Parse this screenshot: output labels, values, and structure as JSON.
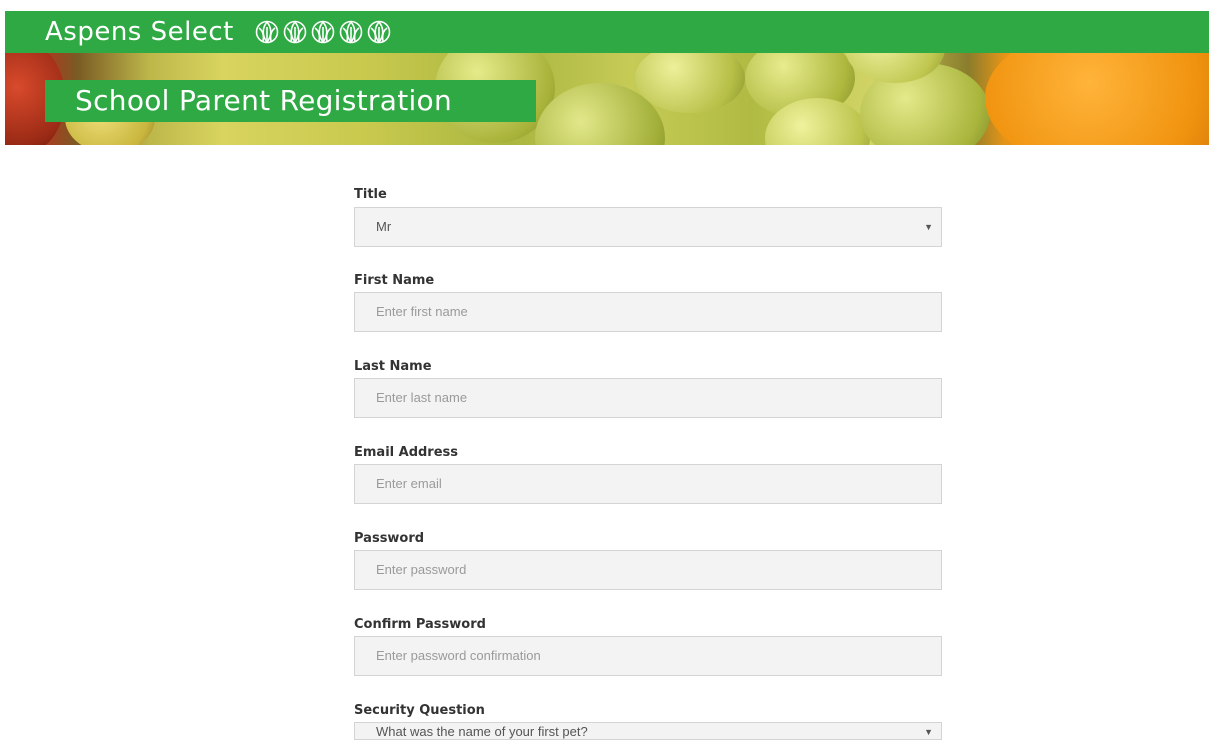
{
  "header": {
    "brand": "Aspens Select",
    "logo_icons": [
      "aspen-leaf-icon",
      "aspen-leaf-icon",
      "aspen-leaf-icon",
      "aspen-leaf-icon",
      "aspen-leaf-icon"
    ]
  },
  "banner": {
    "title": "School Parent Registration"
  },
  "form": {
    "title": {
      "label": "Title",
      "value": "Mr"
    },
    "first_name": {
      "label": "First Name",
      "placeholder": "Enter first name"
    },
    "last_name": {
      "label": "Last Name",
      "placeholder": "Enter last name"
    },
    "email": {
      "label": "Email Address",
      "placeholder": "Enter email"
    },
    "password": {
      "label": "Password",
      "placeholder": "Enter password"
    },
    "confirm_password": {
      "label": "Confirm Password",
      "placeholder": "Enter password confirmation"
    },
    "security_question": {
      "label": "Security Question",
      "value": "What was the name of your first pet?"
    }
  },
  "colors": {
    "brand_green": "#2ea943",
    "field_bg": "#f3f3f3",
    "field_border": "#d4d4d4"
  }
}
